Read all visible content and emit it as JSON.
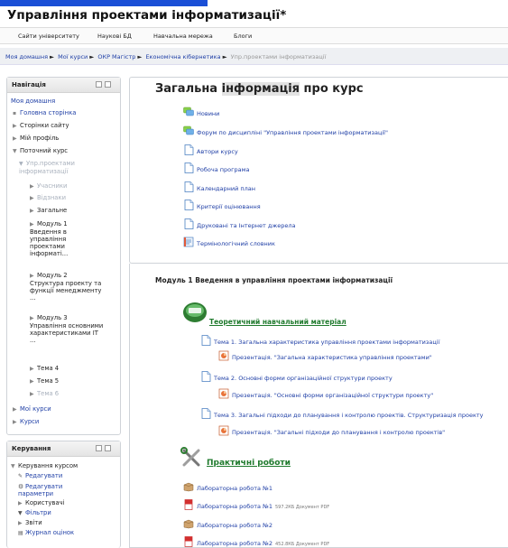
{
  "site": {
    "title": "Управління проектами інформатизації*"
  },
  "navbar": [
    "Сайти університету",
    "Наукові БД",
    "Навчальна мережа",
    "Блоги"
  ],
  "breadcrumb": {
    "items": [
      "Моя домашня",
      "Мої курси",
      "ОКР Магістр",
      "Економічна кібернетика"
    ],
    "current": "Упр.проектами інформатизації",
    "separator": "►"
  },
  "nav_block": {
    "title": "Навігація",
    "home": "Моя домашня",
    "items": [
      {
        "label": "Головна сторінка"
      },
      {
        "label": "Сторінки сайту"
      },
      {
        "label": "Мій профіль"
      },
      {
        "label": "Поточний курс"
      },
      {
        "label": "Упр.проектами інформатизації"
      },
      {
        "label": "Учасники"
      },
      {
        "label": "Відзнаки"
      },
      {
        "label": "Загальне"
      },
      {
        "label": "Модуль 1 Введення в управління проектами інформаті..."
      },
      {
        "label": "Модуль 2 Структура проекту та функції менеджменту ..."
      },
      {
        "label": "Модуль 3 Управління основними характеристиками IT ..."
      },
      {
        "label": "Тема 4"
      },
      {
        "label": "Тема 5"
      },
      {
        "label": "Тема 6"
      },
      {
        "label": "Мої курси"
      },
      {
        "label": "Курси"
      }
    ]
  },
  "admin_block": {
    "title": "Керування",
    "items": [
      {
        "label": "Керування курсом"
      },
      {
        "label": "Редагувати"
      },
      {
        "label": "Редагувати параметри"
      },
      {
        "label": "Користувачі"
      },
      {
        "label": "Фільтри"
      },
      {
        "label": "Звіти"
      },
      {
        "label": "Журнал оцінок"
      }
    ]
  },
  "general": {
    "title_pre": "Загальна ",
    "title_hl": "інформація",
    "title_post": " про курс",
    "resources": [
      {
        "label": "Новини",
        "icon": "forum-icon"
      },
      {
        "label": "Форум по дисципліні \"Управління проектами інформатизації\"",
        "icon": "forum-icon"
      },
      {
        "label": "Автори курсу",
        "icon": "page-icon"
      },
      {
        "label": "Робоча програма",
        "icon": "page-icon"
      },
      {
        "label": "Календарний план",
        "icon": "page-icon"
      },
      {
        "label": "Критерії оцінювання",
        "icon": "page-icon"
      },
      {
        "label": "Друковані та Інтернет джерела",
        "icon": "page-icon"
      },
      {
        "label": "Термінологічний словник",
        "icon": "glossary-icon"
      }
    ]
  },
  "module1": {
    "title": "Модуль 1 Введення в управління проектами інформатизації",
    "theory_label": "Теоретичний навчальний матеріал",
    "topics": [
      {
        "label": "Тема 1. Загальна характеристика управління проектами інформатизації",
        "pres": "Презентація. \"Загальна характеристика управління проектами\""
      },
      {
        "label": "Тема 2. Основні форми організаційної структури проекту",
        "pres": "Презентація. \"Основні форми організаційної структури проекту\""
      },
      {
        "label": "Тема 3. Загальні підходи до планування і контролю проектів. Структуризація проекту",
        "pres": "Презентація. \"Загальні підходи до планування і контролю проектів\""
      }
    ],
    "practical_label": "Практичні роботи",
    "labs": [
      {
        "label": "Лабораторна робота №1",
        "meta": "",
        "icon": "assignment-icon"
      },
      {
        "label": "Лабораторна робота №1",
        "meta": "597.2КБ Документ PDF",
        "icon": "pdf-icon"
      },
      {
        "label": "Лабораторна робота №2",
        "meta": "",
        "icon": "assignment-icon"
      },
      {
        "label": "Лабораторна робота №2",
        "meta": "452.8КБ Документ PDF",
        "icon": "pdf-icon"
      }
    ]
  },
  "colors": {
    "link": "#1f3fa6",
    "green": "#1f7a2d",
    "accent": "#1a4fd6"
  }
}
